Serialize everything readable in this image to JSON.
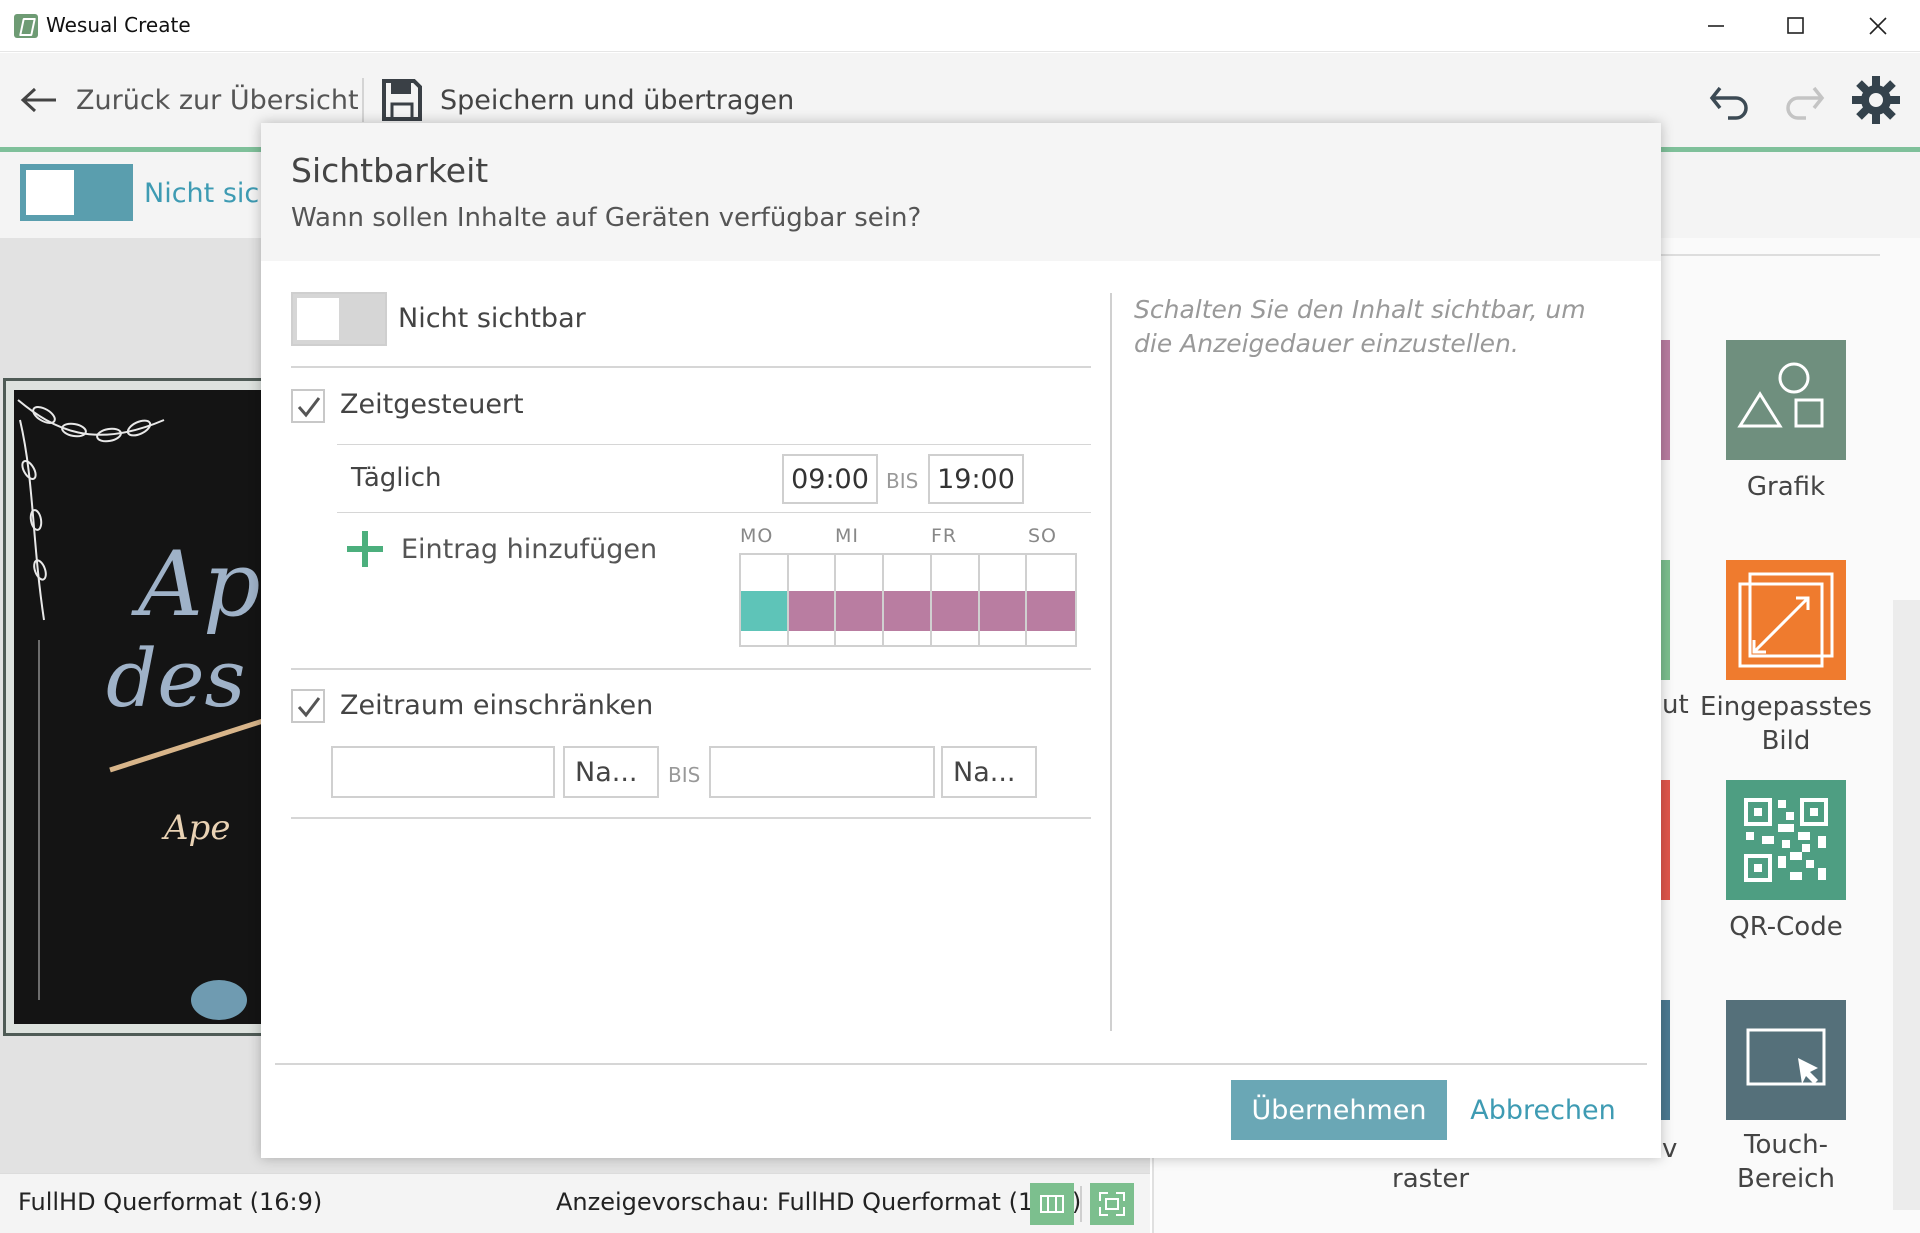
{
  "window": {
    "title": "Wesual Create"
  },
  "toolbar": {
    "back_label": "Zurück zur Übersicht",
    "save_label": "Speichern und übertragen"
  },
  "subbar": {
    "visibility_label": "Nicht sichtbar"
  },
  "canvas": {
    "text_large_1": "Ap",
    "text_large_2": "des",
    "text_small": "Ape"
  },
  "tools": [
    {
      "label": "Grafik",
      "icon": "shapes-icon",
      "color": "#6f8f7e"
    },
    {
      "label": "Eingepasstes Bild",
      "icon": "fit-image-icon",
      "color": "#ef7b2e"
    },
    {
      "label": "QR-Code",
      "icon": "qr-code-icon",
      "color": "#4e9e82"
    },
    {
      "label": "Touch-Bereich",
      "icon": "touch-area-icon",
      "color": "#55707a"
    }
  ],
  "tools_partial": {
    "layout_fragment": "ut",
    "raster_label": "raster",
    "v_fragment": "v"
  },
  "status": {
    "format": "FullHD Querformat (16:9)",
    "preview": "Anzeigevorschau: FullHD Querformat (16:9)"
  },
  "dialog": {
    "title": "Sichtbarkeit",
    "subtitle": "Wann sollen Inhalte auf Geräten verfügbar sein?",
    "visible_toggle": {
      "label": "Nicht sichtbar",
      "on": false
    },
    "timed": {
      "label": "Zeitgesteuert",
      "checked": true,
      "schedule_label": "Täglich",
      "from": "09:00",
      "to": "19:00",
      "bis": "BIS",
      "add_entry_label": "Eintrag hinzufügen",
      "day_labels": [
        "MO",
        "MI",
        "FR",
        "SO"
      ],
      "week_colors": [
        "#5ec4b8",
        "#b97da1",
        "#b97da1",
        "#b97da1",
        "#b97da1",
        "#b97da1",
        "#b97da1"
      ]
    },
    "period": {
      "label": "Zeitraum einschränken",
      "checked": true,
      "start_date": "",
      "start_name": "Na...",
      "bis": "BIS",
      "end_date": "",
      "end_name": "Na..."
    },
    "hint": "Schalten Sie den Inhalt sichtbar, um die Anzeigedauer einzustellen.",
    "apply_label": "Übernehmen",
    "cancel_label": "Abbrechen"
  }
}
